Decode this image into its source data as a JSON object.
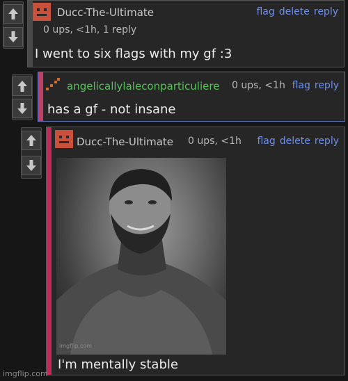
{
  "comments": [
    {
      "username": "Ducc-The-Ultimate",
      "meta": "0 ups, <1h, 1 reply",
      "actions": [
        "flag",
        "delete",
        "reply"
      ],
      "body": "I went to six flags with my gf :3"
    },
    {
      "username": "angelicallylaleconparticuliere",
      "meta": "0 ups, <1h",
      "actions": [
        "flag",
        "reply"
      ],
      "body": "has a gf - not insane"
    },
    {
      "username": "Ducc-The-Ultimate",
      "meta": "0 ups, <1h",
      "actions": [
        "flag",
        "delete",
        "reply"
      ],
      "body": "I'm mentally stable",
      "image_watermark": "imgflip.com"
    }
  ],
  "icons": {
    "upvote": "upvote-arrow-icon",
    "downvote": "downvote-arrow-icon"
  },
  "colors": {
    "stripe1": "#4a4a4a",
    "stripe2": "#c0406a",
    "stripe3": "#c02a58",
    "link": "#6f8fe8",
    "username_green": "#57c25a"
  },
  "footer_watermark": "imgflip.com"
}
